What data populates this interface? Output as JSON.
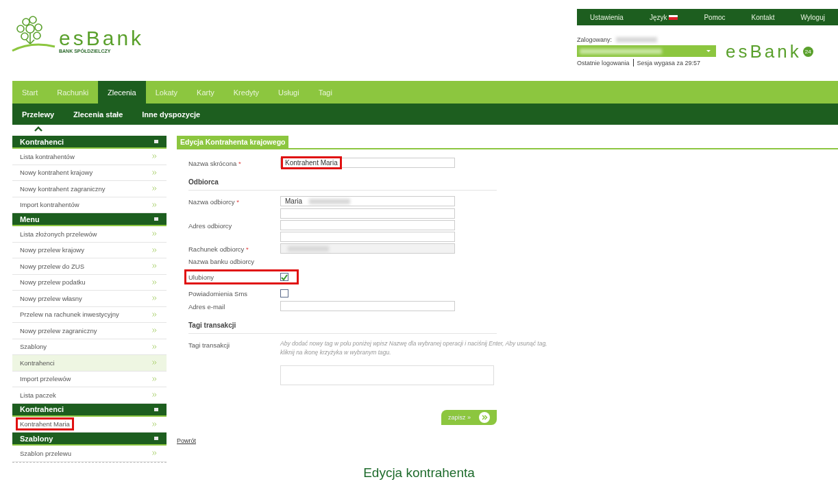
{
  "logo": {
    "name": "esBank",
    "tagline": "BANK SPÓŁDZIELCZY"
  },
  "top_links": [
    {
      "label": "Ustawienia",
      "kind": "link"
    },
    {
      "label": "Język",
      "kind": "language"
    },
    {
      "label": "Pomoc",
      "kind": "link"
    },
    {
      "label": "Kontakt",
      "kind": "link"
    },
    {
      "label": "Wyloguj",
      "kind": "link"
    }
  ],
  "session": {
    "logged_in_label": "Zalogowany:",
    "user_redacted": true,
    "account_redacted": true,
    "last_logins": "Ostatnie logowania",
    "session_expiry": "Sesja wygasa za 29:57"
  },
  "brand": {
    "name": "esBank",
    "badge": "24"
  },
  "main_nav": [
    {
      "label": "Start",
      "selected": false
    },
    {
      "label": "Rachunki",
      "selected": false
    },
    {
      "label": "Zlecenia",
      "selected": true
    },
    {
      "label": "Lokaty",
      "selected": false
    },
    {
      "label": "Karty",
      "selected": false
    },
    {
      "label": "Kredyty",
      "selected": false
    },
    {
      "label": "Usługi",
      "selected": false
    },
    {
      "label": "Tagi",
      "selected": false
    }
  ],
  "sub_nav": [
    {
      "label": "Przelewy",
      "selected": true
    },
    {
      "label": "Zlecenia stałe",
      "selected": false
    },
    {
      "label": "Inne dyspozycje",
      "selected": false
    }
  ],
  "sidebar": {
    "sections": [
      {
        "title": "Kontrahenci",
        "expanded": true,
        "items": [
          {
            "label": "Lista kontrahentów",
            "selected": false,
            "annotated": false
          },
          {
            "label": "Nowy kontrahent krajowy",
            "selected": false,
            "annotated": false
          },
          {
            "label": "Nowy kontrahent zagraniczny",
            "selected": false,
            "annotated": false
          },
          {
            "label": "Import kontrahentów",
            "selected": false,
            "annotated": false
          }
        ]
      },
      {
        "title": "Menu",
        "expanded": true,
        "items": [
          {
            "label": "Lista złożonych przelewów",
            "selected": false,
            "annotated": false
          },
          {
            "label": "Nowy przelew krajowy",
            "selected": false,
            "annotated": false
          },
          {
            "label": "Nowy przelew do ZUS",
            "selected": false,
            "annotated": false
          },
          {
            "label": "Nowy przelew podatku",
            "selected": false,
            "annotated": false
          },
          {
            "label": "Nowy przelew własny",
            "selected": false,
            "annotated": false
          },
          {
            "label": "Przelew na rachunek inwestycyjny",
            "selected": false,
            "annotated": false
          },
          {
            "label": "Nowy przelew zagraniczny",
            "selected": false,
            "annotated": false
          },
          {
            "label": "Szablony",
            "selected": false,
            "annotated": false
          },
          {
            "label": "Kontrahenci",
            "selected": true,
            "annotated": false
          },
          {
            "label": "Import przelewów",
            "selected": false,
            "annotated": false
          },
          {
            "label": "Lista paczek",
            "selected": false,
            "annotated": false
          }
        ]
      },
      {
        "title": "Kontrahenci",
        "expanded": true,
        "items": [
          {
            "label": "Kontrahent Maria",
            "selected": false,
            "annotated": true
          }
        ]
      },
      {
        "title": "Szablony",
        "expanded": true,
        "items": [
          {
            "label": "Szablon przelewu",
            "selected": false,
            "annotated": false
          }
        ]
      }
    ]
  },
  "form": {
    "title": "Edycja Kontrahenta krajowego",
    "required_mark": "*",
    "rows": [
      {
        "kind": "text",
        "label": "Nazwa skrócona",
        "required": true,
        "value": "Kontrahent Maria",
        "annotated": true
      },
      {
        "kind": "heading",
        "label": "Odbiorca"
      },
      {
        "kind": "text",
        "label": "Nazwa odbiorcy",
        "required": true,
        "value": "Maria",
        "redacted": true
      },
      {
        "kind": "address",
        "label": "Adres odbiorcy"
      },
      {
        "kind": "text",
        "label": "Rachunek odbiorcy",
        "required": true,
        "redacted": true,
        "disabled": true
      },
      {
        "kind": "static",
        "label": "Nazwa banku odbiorcy"
      },
      {
        "kind": "checkbox",
        "label": "Ulubiony",
        "checked": true,
        "annotated": true
      },
      {
        "kind": "checkbox",
        "label": "Powiadomienia Sms",
        "checked": false,
        "annotated": false
      },
      {
        "kind": "text",
        "label": "Adres e-mail",
        "required": false
      },
      {
        "kind": "heading",
        "label": "Tagi transakcji"
      },
      {
        "kind": "tags",
        "label": "Tagi transakcji",
        "hint": "Aby dodać nowy tag w polu poniżej wpisz Nazwę dla wybranej operacji i naciśnij Enter, Aby usunąć tag, kliknij na ikonę krzyżyka w wybranym tagu."
      }
    ],
    "submit": "zapisz »",
    "back": "Powrót"
  },
  "caption": "Edycja kontrahenta"
}
